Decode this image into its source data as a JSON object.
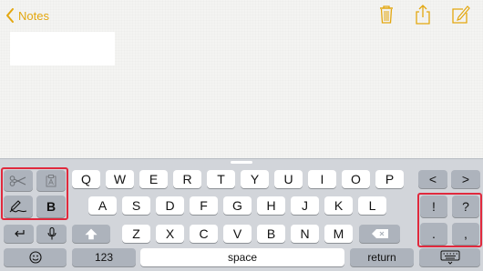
{
  "nav": {
    "back_label": "Notes",
    "accent_color": "#e3a70f",
    "icons": [
      "trash-icon",
      "share-icon",
      "compose-icon"
    ]
  },
  "note": {
    "text": ""
  },
  "keyboard": {
    "shortcuts": {
      "cut_icon": "scissors-icon",
      "paste_icon": "clipboard-icon",
      "handwriting_icon": "pen-icon",
      "bold_label": "B"
    },
    "row1": [
      "Q",
      "W",
      "E",
      "R",
      "T",
      "Y",
      "U",
      "I",
      "O",
      "P"
    ],
    "row2": [
      "A",
      "S",
      "D",
      "F",
      "G",
      "H",
      "J",
      "K",
      "L"
    ],
    "row3": [
      "Z",
      "X",
      "C",
      "V",
      "B",
      "N",
      "M"
    ],
    "arrows": {
      "left": "<",
      "right": ">"
    },
    "punct": [
      "!",
      "?",
      ".",
      ","
    ],
    "bottom": {
      "numbers_label": "123",
      "space_label": "space",
      "return_label": "return"
    },
    "highlight_color": "#e0293d"
  }
}
